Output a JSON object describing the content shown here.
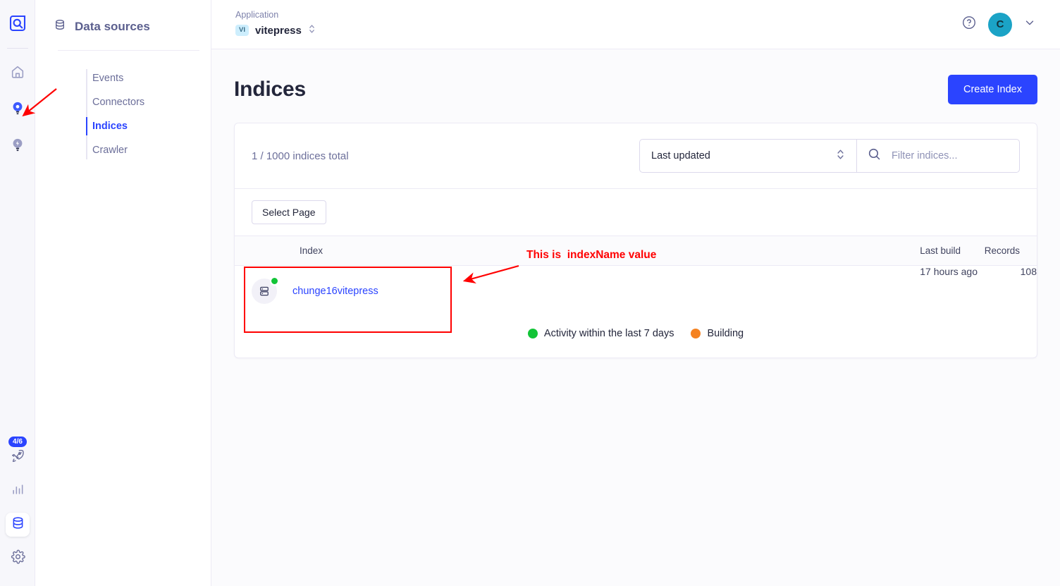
{
  "colors": {
    "brand_blue": "#2b44ff",
    "annotation_red": "#ff0000",
    "status_green": "#12c437",
    "status_orange": "#f58220",
    "avatar_teal": "#1ba3c6",
    "app_badge_bg": "#cdeefd"
  },
  "rail": {
    "logo_icon": "algolia-logo-icon",
    "items": [
      {
        "icon": "home-icon",
        "name": "home",
        "active": false
      },
      {
        "icon": "search-icon",
        "name": "search",
        "active": true
      },
      {
        "icon": "recommend-bulb-icon",
        "name": "recommend",
        "active": false
      }
    ],
    "bottom_items": [
      {
        "icon": "rocket-icon",
        "name": "onboarding",
        "badge": "4/6",
        "active": false
      },
      {
        "icon": "bar-chart-icon",
        "name": "analytics",
        "active": false
      },
      {
        "icon": "database-icon",
        "name": "data-sources",
        "active": true
      },
      {
        "icon": "gear-icon",
        "name": "settings",
        "active": false
      }
    ]
  },
  "sidebar": {
    "title": "Data sources",
    "title_icon": "database-icon",
    "items": [
      {
        "label": "Events",
        "selected": false
      },
      {
        "label": "Connectors",
        "selected": false
      },
      {
        "label": "Indices",
        "selected": true
      },
      {
        "label": "Crawler",
        "selected": false
      }
    ]
  },
  "topbar": {
    "application_label": "Application",
    "application_initials": "vi",
    "application_name": "vitepress",
    "selector_icon": "chevron-updown-icon",
    "help_icon": "help-circle-icon",
    "avatar_initial": "C",
    "avatar_chevron_icon": "chevron-down-icon"
  },
  "page": {
    "title": "Indices",
    "create_button": "Create Index"
  },
  "toolbar": {
    "count_text": "1 / 1000 indices total",
    "sort_value": "Last updated",
    "sort_icon": "chevron-updown-icon",
    "search_icon": "search-icon",
    "search_placeholder": "Filter indices...",
    "search_value": "",
    "select_page_button": "Select Page"
  },
  "table": {
    "columns": {
      "index": "Index",
      "last_build": "Last build",
      "records": "Records"
    },
    "rows": [
      {
        "icon": "index-database-icon",
        "status": "green",
        "name": "chunge16vitepress",
        "last_build": "17 hours ago",
        "records": "108"
      }
    ]
  },
  "legend": [
    {
      "color": "#12c437",
      "label": "Activity within the last 7 days"
    },
    {
      "color": "#f58220",
      "label": "Building"
    }
  ],
  "annotations": {
    "callout_text": "This is  indexName value",
    "arrow_rail_name": "red-arrow-to-search-icon",
    "arrow_index_name": "red-arrow-to-index-name",
    "highlight_box_name": "red-highlight-index-cell"
  }
}
